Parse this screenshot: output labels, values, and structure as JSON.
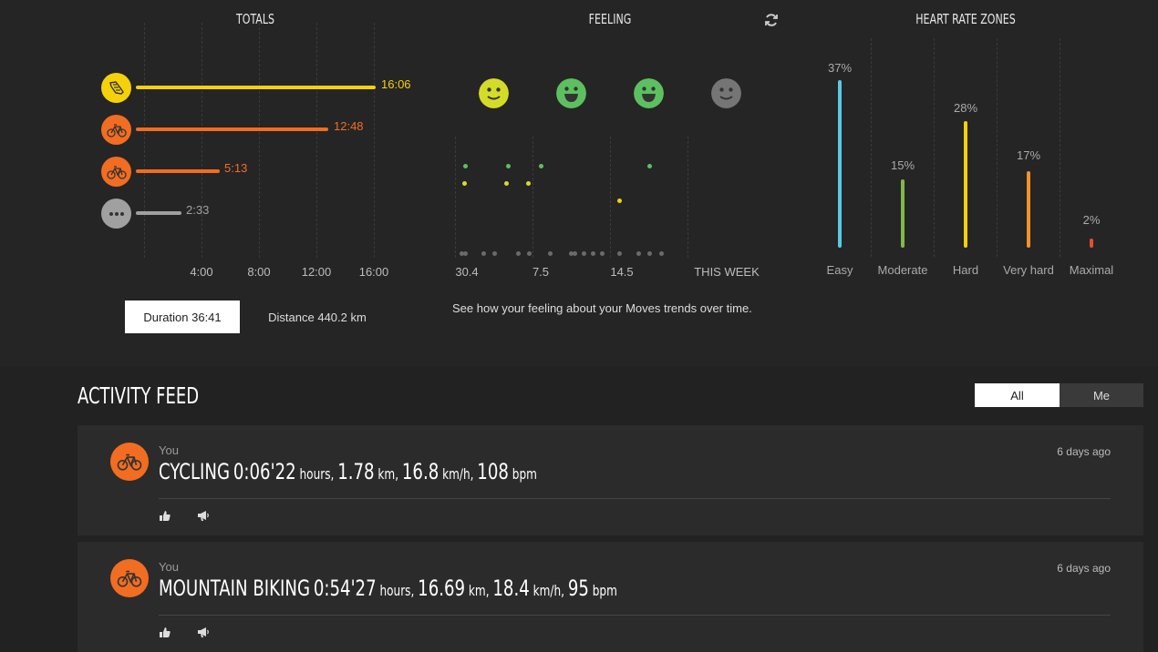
{
  "totals": {
    "title": "TOTALS",
    "rows": [
      {
        "sport": "running",
        "icon": "shoe-icon",
        "color": "#f5d10a",
        "value": "16:06",
        "hours": 16.1
      },
      {
        "sport": "cycling",
        "icon": "bike-icon",
        "color": "#f26d21",
        "value": "12:48",
        "hours": 12.8
      },
      {
        "sport": "mountain-biking",
        "icon": "bike-icon",
        "color": "#f26d21",
        "value": "5:13",
        "hours": 5.217
      },
      {
        "sport": "other",
        "icon": "more-icon",
        "color": "#a0a0a0",
        "value": "2:33",
        "hours": 2.55
      }
    ],
    "ticks": [
      "4:00",
      "8:00",
      "12:00",
      "16:00"
    ],
    "duration_button": "Duration 36:41",
    "distance_button": "Distance 440.2 km"
  },
  "feeling": {
    "title": "FEELING",
    "faces": [
      {
        "mood": "neutral",
        "color": "#d4dc28"
      },
      {
        "mood": "happy",
        "color": "#5cc060"
      },
      {
        "mood": "happy",
        "color": "#5cc060"
      },
      {
        "mood": "neutral",
        "color": "#757575"
      }
    ],
    "ticks": [
      "30.4",
      "7.5",
      "14.5",
      "THIS WEEK"
    ],
    "caption": "See how your feeling about your Moves trends over time."
  },
  "heart_rate": {
    "title": "HEART RATE ZONES",
    "zones": [
      {
        "label": "Easy",
        "pct": "37%",
        "value": 37,
        "color": "#5bc8e6"
      },
      {
        "label": "Moderate",
        "pct": "15%",
        "value": 15,
        "color": "#82b948"
      },
      {
        "label": "Hard",
        "pct": "28%",
        "value": 28,
        "color": "#f5d10a"
      },
      {
        "label": "Very hard",
        "pct": "17%",
        "value": 17,
        "color": "#f3922c"
      },
      {
        "label": "Maximal",
        "pct": "2%",
        "value": 2,
        "color": "#e84c2e"
      }
    ]
  },
  "feed": {
    "title": "ACTIVITY FEED",
    "filter_all": "All",
    "filter_me": "Me",
    "items": [
      {
        "who": "You",
        "ago": "6 days ago",
        "sport": "CYCLING",
        "duration": "0:06'22",
        "duration_unit": "hours,",
        "distance": "1.78",
        "distance_unit": "km,",
        "speed": "16.8",
        "speed_unit": "km/h,",
        "hr": "108",
        "hr_unit": "bpm"
      },
      {
        "who": "You",
        "ago": "6 days ago",
        "sport": "MOUNTAIN BIKING",
        "duration": "0:54'27",
        "duration_unit": "hours,",
        "distance": "16.69",
        "distance_unit": "km,",
        "speed": "18.4",
        "speed_unit": "km/h,",
        "hr": "95",
        "hr_unit": "bpm"
      }
    ]
  }
}
